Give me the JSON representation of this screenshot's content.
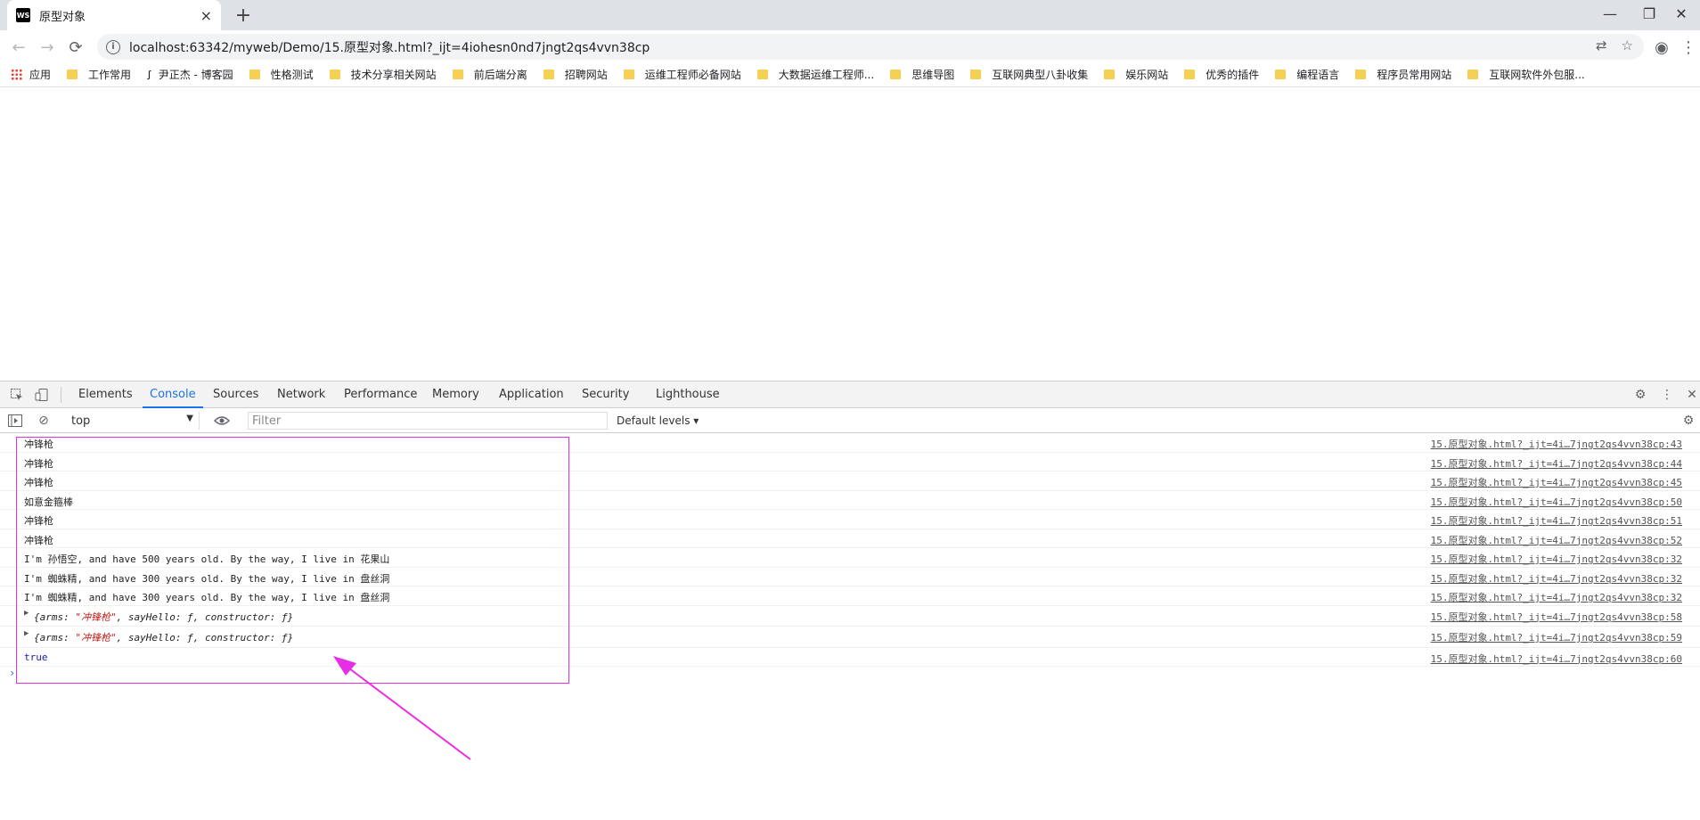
{
  "tab": {
    "favicon": "WS",
    "title": "原型对象",
    "close": "×"
  },
  "new_tab": "+",
  "window": {
    "minimize": "—",
    "restore": "❐",
    "close": "✕"
  },
  "nav": {
    "back": "←",
    "forward": "→",
    "reload": "⟳"
  },
  "address": {
    "url": "localhost:63342/myweb/Demo/15.原型对象.html?_ijt=4iohesn0nd7jngt2qs4vvn38cp",
    "info": "i"
  },
  "omni_icons": {
    "translate": "⇄",
    "star": "☆"
  },
  "toolbar_icons": {
    "profile": "◉",
    "menu": "⋮"
  },
  "bookmarks": [
    {
      "label": "应用",
      "icon": "apps-grid"
    },
    {
      "label": "工作常用",
      "icon": "folder"
    },
    {
      "label": "尹正杰 - 博客园",
      "icon": "blog"
    },
    {
      "label": "性格测试",
      "icon": "folder"
    },
    {
      "label": "技术分享相关网站",
      "icon": "folder"
    },
    {
      "label": "前后端分离",
      "icon": "folder"
    },
    {
      "label": "招聘网站",
      "icon": "folder"
    },
    {
      "label": "运维工程师必备网站",
      "icon": "folder"
    },
    {
      "label": "大数据运维工程师...",
      "icon": "folder"
    },
    {
      "label": "思维导图",
      "icon": "folder"
    },
    {
      "label": "互联网典型八卦收集",
      "icon": "folder"
    },
    {
      "label": "娱乐网站",
      "icon": "folder"
    },
    {
      "label": "优秀的插件",
      "icon": "folder"
    },
    {
      "label": "编程语言",
      "icon": "folder"
    },
    {
      "label": "程序员常用网站",
      "icon": "folder"
    },
    {
      "label": "互联网软件外包服...",
      "icon": "folder"
    }
  ],
  "devtools": {
    "tabs": [
      "Elements",
      "Console",
      "Sources",
      "Network",
      "Performance",
      "Memory",
      "Application",
      "Security",
      "Lighthouse"
    ],
    "active_tab": "Console",
    "context": "top",
    "filter_placeholder": "Filter",
    "levels": "Default levels ▾",
    "icons": {
      "inspect": "inspect-icon",
      "device": "device-toggle-icon",
      "settings": "⚙",
      "more": "⋮",
      "close": "✕",
      "sidebar": "▷",
      "clear": "⊘",
      "eye": "👁"
    }
  },
  "console": {
    "rows": [
      {
        "text": "冲锋枪",
        "src": "15.原型对象.html?_ijt=4i…7jngt2qs4vvn38cp:43"
      },
      {
        "text": "冲锋枪",
        "src": "15.原型对象.html?_ijt=4i…7jngt2qs4vvn38cp:44"
      },
      {
        "text": "冲锋枪",
        "src": "15.原型对象.html?_ijt=4i…7jngt2qs4vvn38cp:45"
      },
      {
        "text": "如意金箍棒",
        "src": "15.原型对象.html?_ijt=4i…7jngt2qs4vvn38cp:50"
      },
      {
        "text": "冲锋枪",
        "src": "15.原型对象.html?_ijt=4i…7jngt2qs4vvn38cp:51"
      },
      {
        "text": "冲锋枪",
        "src": "15.原型对象.html?_ijt=4i…7jngt2qs4vvn38cp:52"
      },
      {
        "text": "I'm 孙悟空, and have 500 years old. By the way, I live in 花果山",
        "src": "15.原型对象.html?_ijt=4i…7jngt2qs4vvn38cp:32"
      },
      {
        "text": "I'm 蜘蛛精, and have 300 years old. By the way, I live in 盘丝洞",
        "src": "15.原型对象.html?_ijt=4i…7jngt2qs4vvn38cp:32"
      },
      {
        "text": "I'm 蜘蛛精, and have 300 years old. By the way, I live in 盘丝洞",
        "src": "15.原型对象.html?_ijt=4i…7jngt2qs4vvn38cp:32"
      }
    ],
    "objects": [
      {
        "pre": "{arms: ",
        "str": "\"冲锋枪\"",
        "post": ", sayHello: ƒ, constructor: ƒ}",
        "src": "15.原型对象.html?_ijt=4i…7jngt2qs4vvn38cp:58"
      },
      {
        "pre": "{arms: ",
        "str": "\"冲锋枪\"",
        "post": ", sayHello: ƒ, constructor: ƒ}",
        "src": "15.原型对象.html?_ijt=4i…7jngt2qs4vvn38cp:59"
      }
    ],
    "bool_row": {
      "text": "true",
      "src": "15.原型对象.html?_ijt=4i…7jngt2qs4vvn38cp:60"
    },
    "prompt": "›"
  },
  "colors": {
    "highlight": "#e62ee6",
    "accent": "#1a73e8",
    "string": "#c41a16"
  }
}
